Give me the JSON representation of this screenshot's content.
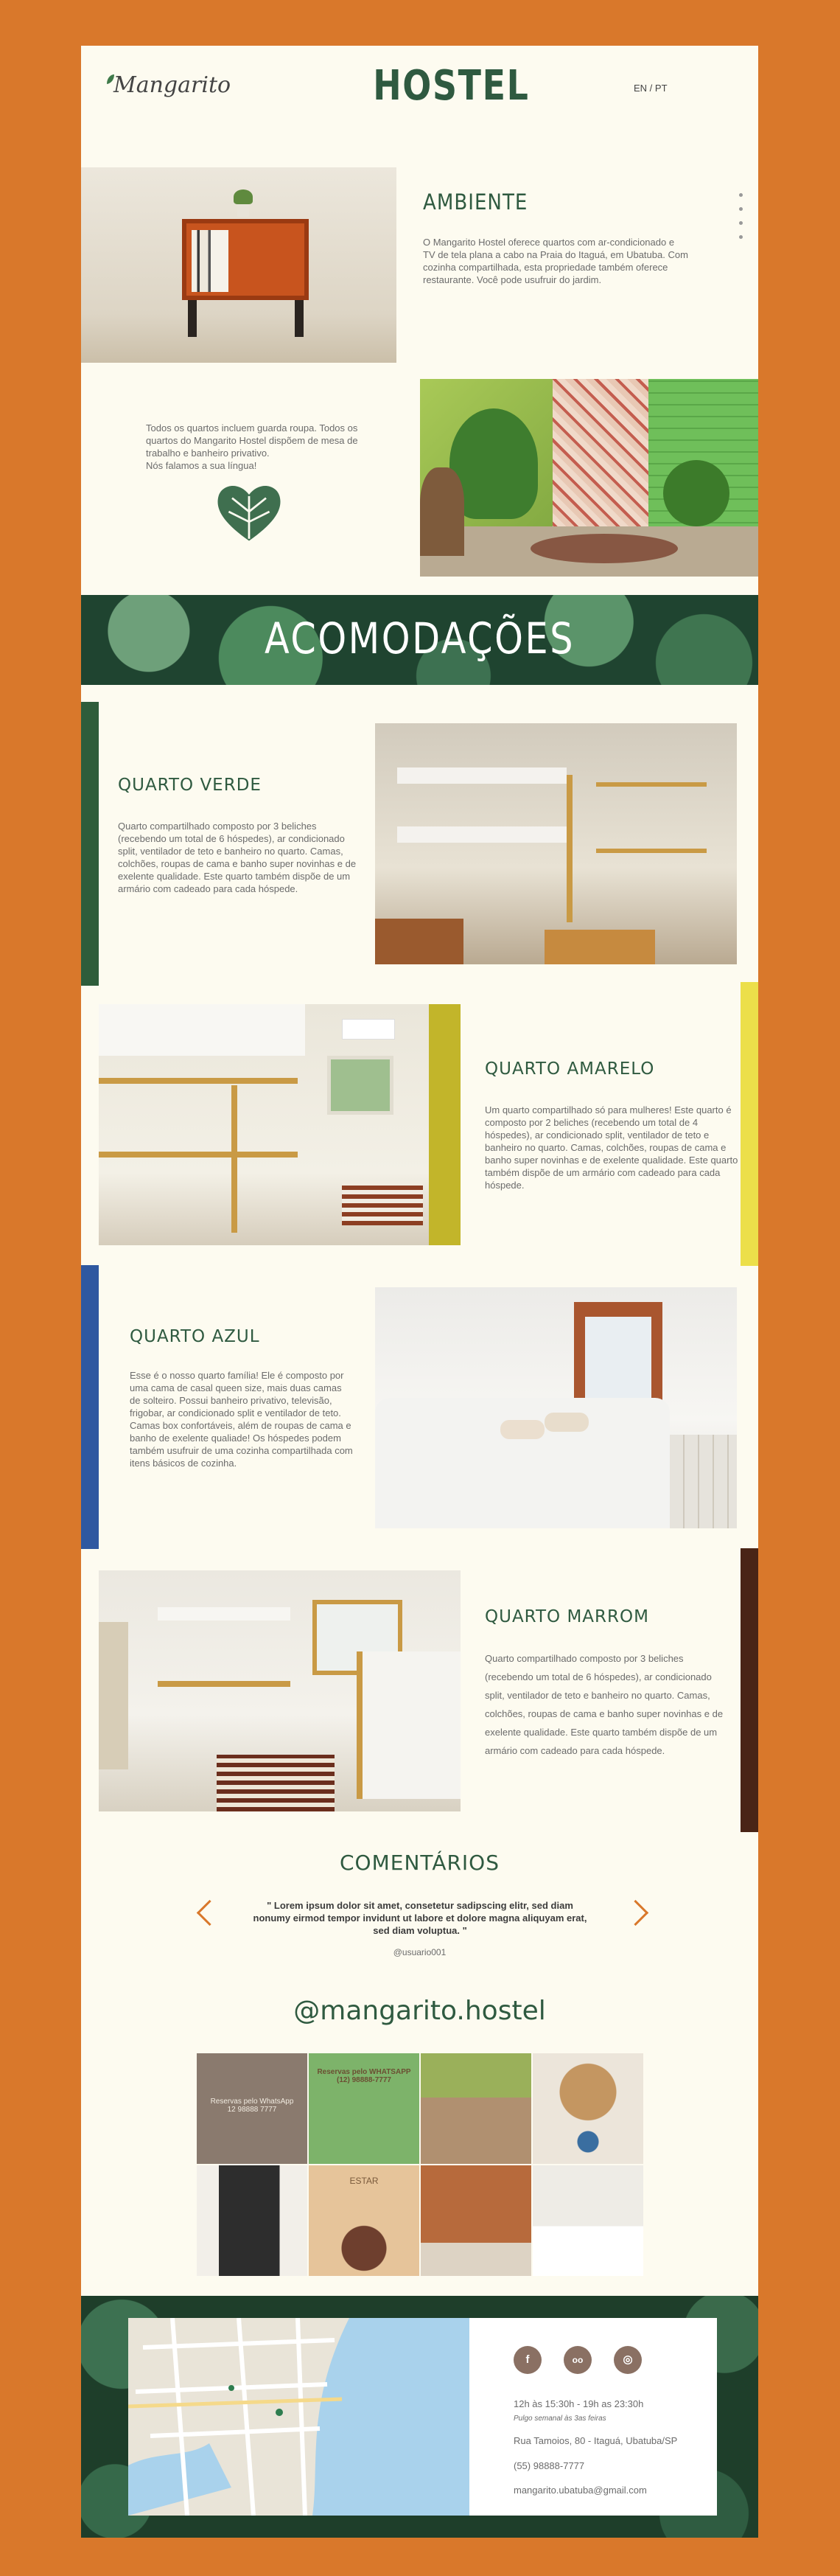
{
  "header": {
    "brand": "Mangarito",
    "title": "HOSTEL",
    "language": "EN / PT"
  },
  "ambiente": {
    "title": "AMBIENTE",
    "description": "O Mangarito Hostel oferece quartos com ar-condicionado e TV de tela plana a cabo na Praia do Itaguá, em Ubatuba. Com cozinha compartilhada, esta propriedade também oferece restaurante. Você pode usufruir do jardim.",
    "note": "Todos os quartos incluem guarda roupa. Todos os quartos do Mangarito Hostel dispõem de mesa de trabalho e banheiro privativo.\nNós falamos a sua língua!"
  },
  "accommodations": {
    "title": "ACOMODAÇÕES",
    "rooms": [
      {
        "title": "QUARTO VERDE",
        "description": "Quarto compartilhado composto por 3 beliches (recebendo um total de 6 hóspedes), ar condicionado split, ventilador de teto e banheiro no quarto. Camas, colchões, roupas de cama e banho super novinhas e de exelente qualidade. Este quarto também dispõe de um armário com cadeado para cada hóspede.",
        "color": "#2e5d3b"
      },
      {
        "title": "QUARTO AMARELO",
        "description": "Um quarto compartilhado só para mulheres! Este quarto é composto por 2 beliches (recebendo um total de 4 hóspedes), ar condicionado split, ventilador de teto e banheiro no quarto. Camas, colchões, roupas de cama e banho super novinhas e de exelente qualidade. Este quarto também dispõe de um armário com cadeado para cada hóspede.",
        "color": "#ecdf4a"
      },
      {
        "title": "QUARTO AZUL",
        "description": "Esse é o nosso quarto família! Ele é composto por uma cama de casal queen size, mais duas camas de solteiro. Possui banheiro privativo, televisão, frigobar, ar condicionado split e ventilador de teto. Camas box confortáveis, além de roupas de cama e banho de exelente qualiade! Os hóspedes podem também usufruir de uma cozinha compartilhada com itens básicos de cozinha.",
        "color": "#2f58a0"
      },
      {
        "title": "QUARTO MARROM",
        "description": "Quarto compartilhado composto por 3 beliches (recebendo um total de 6 hóspedes), ar condicionado split, ventilador de teto e banheiro no quarto. Camas, colchões, roupas de cama e banho super novinhas e de exelente qualidade. Este quarto também dispõe de um armário com cadeado para cada hóspede.",
        "color": "#4a2416"
      }
    ]
  },
  "comments": {
    "title": "COMENTÁRIOS",
    "quote": "\" Lorem ipsum dolor sit amet, consetetur sadipscing elitr, sed diam nonumy eirmod tempor invidunt ut labore et dolore magna aliquyam erat, sed diam voluptua. \"",
    "user": "@usuario001"
  },
  "instagram": {
    "handle": "@mangarito.hostel",
    "tile1_text": "Reservas pelo WhatsApp\n12 98888 7777",
    "tile2_text": "Reservas pelo WHATSAPP\n(12) 98888-7777",
    "tile6_text": "ESTAR"
  },
  "contact": {
    "hours": "12h às 15:30h - 19h as 23:30h",
    "hours_note": "Pulgo semanal às 3as feiras",
    "address": "Rua Tamoios, 80 - Itaguá, Ubatuba/SP",
    "phone": "(55) 98888-7777",
    "email": "mangarito.ubatuba@gmail.com",
    "social": [
      {
        "icon": "facebook-icon",
        "glyph": "f"
      },
      {
        "icon": "tripadvisor-icon",
        "glyph": "oo"
      },
      {
        "icon": "instagram-icon",
        "glyph": "◎"
      }
    ]
  }
}
